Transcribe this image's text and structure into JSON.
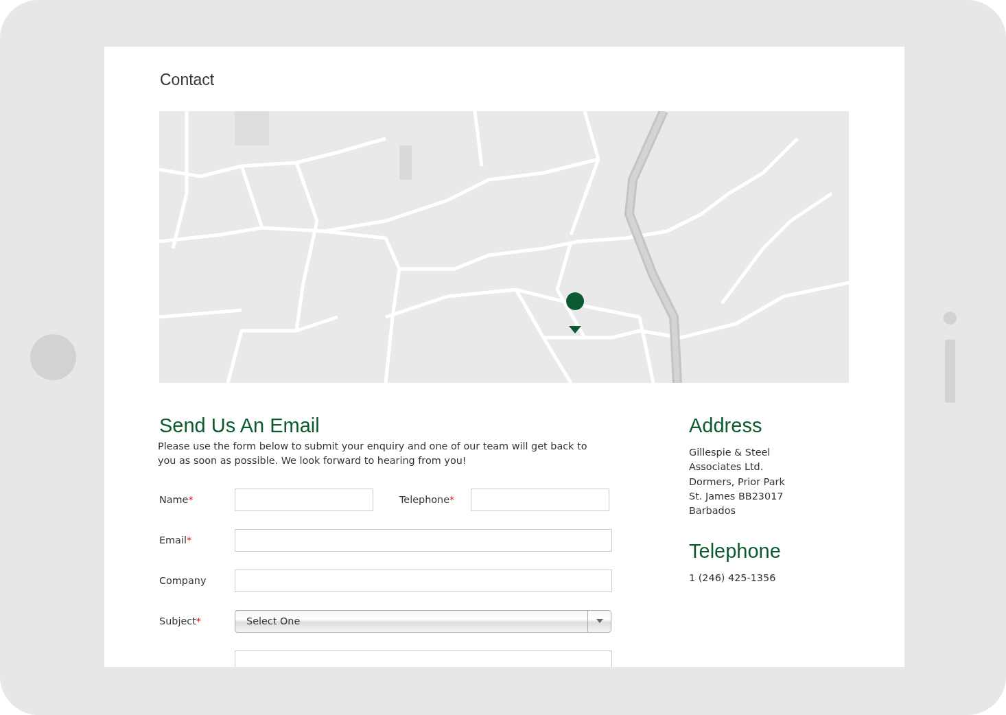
{
  "page": {
    "title": "Contact"
  },
  "form": {
    "heading": "Send Us An Email",
    "intro": "Please use the form below to submit your enquiry and one of our team will get back to you as soon as possible. We look forward to hearing from you!",
    "rows": [
      {
        "fields": [
          {
            "kind": "text",
            "label": "Name",
            "required_mark": "*"
          },
          {
            "kind": "text",
            "label": "Telephone",
            "required_mark": "*"
          }
        ]
      },
      {
        "fields": [
          {
            "kind": "text",
            "label": "Email",
            "required_mark": "*"
          }
        ]
      },
      {
        "fields": [
          {
            "kind": "text",
            "label": "Company"
          }
        ]
      },
      {
        "fields": [
          {
            "kind": "select",
            "label": "Subject",
            "required_mark": "*",
            "value": "Select One"
          }
        ]
      },
      {
        "fields": [
          {
            "kind": "text"
          }
        ]
      }
    ]
  },
  "address": {
    "heading": "Address",
    "lines": [
      "Gillespie & Steel",
      "Associates Ltd.",
      "Dormers, Prior Park",
      "St. James BB23017",
      "Barbados"
    ]
  },
  "telephone": {
    "heading": "Telephone",
    "number": "1 (246) 425-1356"
  }
}
